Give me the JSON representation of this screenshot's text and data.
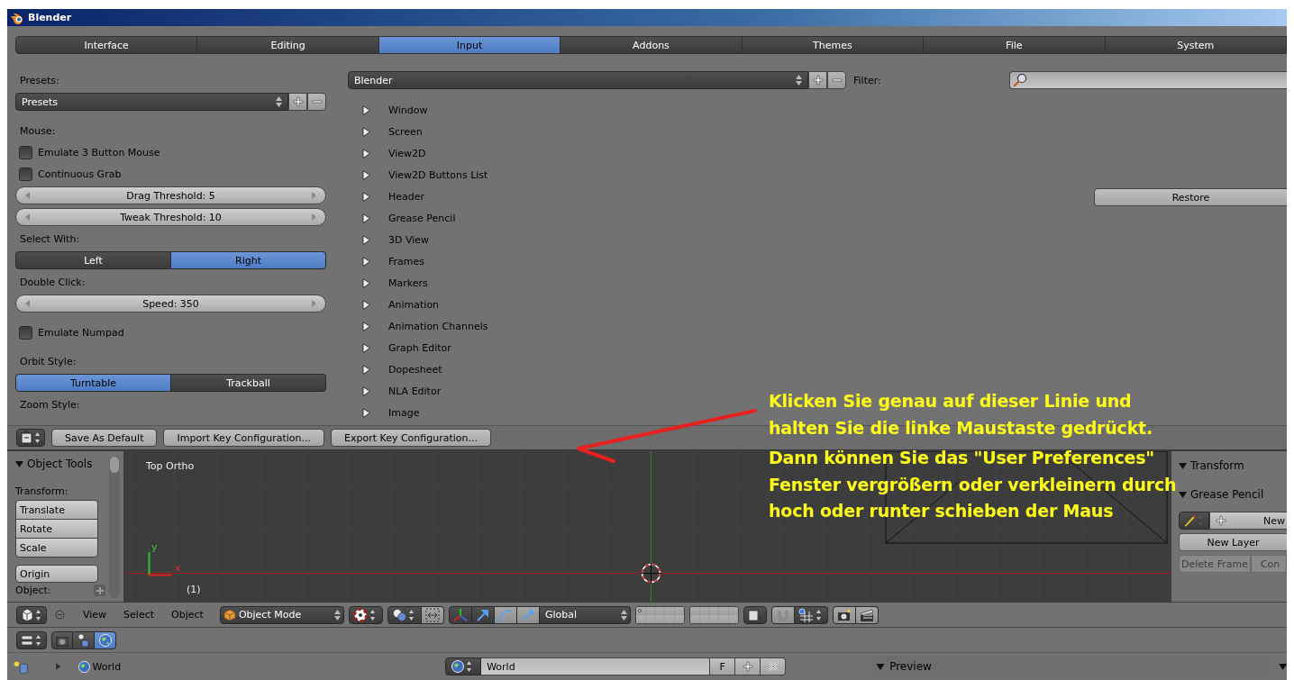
{
  "window": {
    "title": "Blender"
  },
  "tabs": [
    {
      "label": "Interface",
      "selected": false
    },
    {
      "label": "Editing",
      "selected": false
    },
    {
      "label": "Input",
      "selected": true
    },
    {
      "label": "Addons",
      "selected": false
    },
    {
      "label": "Themes",
      "selected": false
    },
    {
      "label": "File",
      "selected": false
    },
    {
      "label": "System",
      "selected": false
    }
  ],
  "input_settings": [
    {
      "kind": "label",
      "text": "Presets:"
    },
    {
      "kind": "dropdown",
      "text": "Presets"
    },
    {
      "kind": "label",
      "text": "Mouse:"
    },
    {
      "kind": "checkbox",
      "text": "Emulate 3 Button Mouse",
      "checked": false
    },
    {
      "kind": "checkbox",
      "text": "Continuous Grab",
      "checked": false
    },
    {
      "kind": "number",
      "text": "Drag Threshold: 5"
    },
    {
      "kind": "number",
      "text": "Tweak Threshold: 10"
    },
    {
      "kind": "label",
      "text": "Select With:"
    },
    {
      "kind": "toggle",
      "options": [
        {
          "label": "Left",
          "selected": false
        },
        {
          "label": "Right",
          "selected": true
        }
      ]
    },
    {
      "kind": "label",
      "text": "Double Click:"
    },
    {
      "kind": "number",
      "text": "Speed: 350"
    },
    {
      "kind": "checkbox",
      "text": "Emulate Numpad",
      "checked": false
    },
    {
      "kind": "label",
      "text": "Orbit Style:"
    },
    {
      "kind": "toggle",
      "options": [
        {
          "label": "Turntable",
          "selected": true
        },
        {
          "label": "Trackball",
          "selected": false
        }
      ]
    },
    {
      "kind": "label",
      "text": "Zoom Style:"
    }
  ],
  "keymap": {
    "preset": "Blender",
    "filter_label": "Filter:",
    "restore_button": "Restore",
    "items": [
      {
        "label": "Window",
        "expanded": false
      },
      {
        "label": "Screen",
        "expanded": false
      },
      {
        "label": "View2D",
        "expanded": false
      },
      {
        "label": "View2D Buttons List",
        "expanded": false
      },
      {
        "label": "Header",
        "expanded": false
      },
      {
        "label": "Grease Pencil",
        "expanded": false
      },
      {
        "label": "3D View",
        "expanded": false
      },
      {
        "label": "Frames",
        "expanded": false
      },
      {
        "label": "Markers",
        "expanded": false
      },
      {
        "label": "Animation",
        "expanded": false
      },
      {
        "label": "Animation Channels",
        "expanded": false
      },
      {
        "label": "Graph Editor",
        "expanded": false
      },
      {
        "label": "Dopesheet",
        "expanded": false
      },
      {
        "label": "NLA Editor",
        "expanded": false
      },
      {
        "label": "Image",
        "expanded": false
      }
    ]
  },
  "footer_buttons": [
    "Save As Default",
    "Import Key Configuration...",
    "Export Key Configuration..."
  ],
  "tool_shelf": {
    "title": "Object Tools",
    "expanded": true,
    "transform_label": "Transform:",
    "transform_buttons": [
      "Translate",
      "Rotate",
      "Scale"
    ],
    "origin_button": "Origin",
    "object_label": "Object:"
  },
  "viewport": {
    "view_name": "Top Ortho",
    "axis_y": "y",
    "axis_x": "x",
    "frame": "(1)"
  },
  "properties_region": {
    "panels": [
      {
        "title": "Transform",
        "expanded": true
      },
      {
        "title": "Grease Pencil",
        "expanded": true
      }
    ],
    "new_button": "New",
    "new_layer_button": "New Layer",
    "delete_frame_button": "Delete Frame",
    "copy_button": "Con"
  },
  "header_3d": {
    "menus": [
      "View",
      "Select",
      "Object"
    ],
    "mode": "Object Mode",
    "orientation": "Global"
  },
  "properties_header": {
    "tabs": [
      {
        "kind": "render",
        "selected": false
      },
      {
        "kind": "scene",
        "selected": false
      },
      {
        "kind": "world",
        "selected": true
      }
    ]
  },
  "world_context": {
    "path_item": "World",
    "datablock": "World",
    "fake_user": "F",
    "preview_panel": {
      "title": "Preview",
      "expanded": true
    }
  },
  "annotation": {
    "lines": [
      "Klicken Sie genau auf dieser Linie und",
      "halten Sie die linke Maustaste gedrückt.",
      "Dann können Sie das \"User Preferences\"",
      "Fenster vergrößern oder verkleinern durch",
      "hoch oder runter schieben der Maus"
    ]
  }
}
